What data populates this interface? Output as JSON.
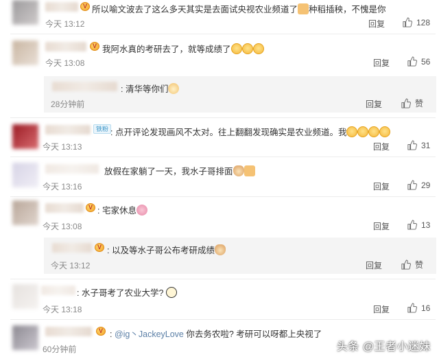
{
  "comments": [
    {
      "text": "所以喻文波去了这么多天其实是去面试央视农业频道了",
      "text_tail": "种稻插秧，不愧是你",
      "time": "今天 13:12",
      "reply": "回复",
      "likes": "128"
    },
    {
      "text": "我阿水真的考研去了，就等成绩了",
      "time": "今天 13:08",
      "reply": "回复",
      "likes": "56",
      "sub": {
        "text": "清华等你们",
        "time": "28分钟前",
        "reply": "回复",
        "like_label": "赞"
      }
    },
    {
      "badge": "铁粉",
      "text": "点开评论发现画风不太对。往上翻翻发现确实是农业频道。我",
      "time": "今天 13:13",
      "reply": "回复",
      "likes": "31"
    },
    {
      "text": "放假在家躺了一天，我水子哥排面",
      "time": "今天 13:16",
      "reply": "回复",
      "likes": "29"
    },
    {
      "text": "宅家休息",
      "time": "今天 13:08",
      "reply": "回复",
      "likes": "13",
      "sub": {
        "text": "以及等水子哥公布考研成绩",
        "time": "今天 13:12",
        "reply": "回复",
        "like_label": "赞"
      }
    },
    {
      "text": "水子哥考了农业大学?",
      "time": "今天 13:18",
      "reply": "回复",
      "likes": "16"
    },
    {
      "mention": "@ig丶JackeyLove",
      "text": " 你去务农啦? 考研可以呀都上央视了",
      "time": "60分钟前"
    }
  ],
  "watermark": "头条 @王者小迷妹",
  "colors": {
    "link": "#5b7fa6",
    "badge": "#3d97c9"
  }
}
